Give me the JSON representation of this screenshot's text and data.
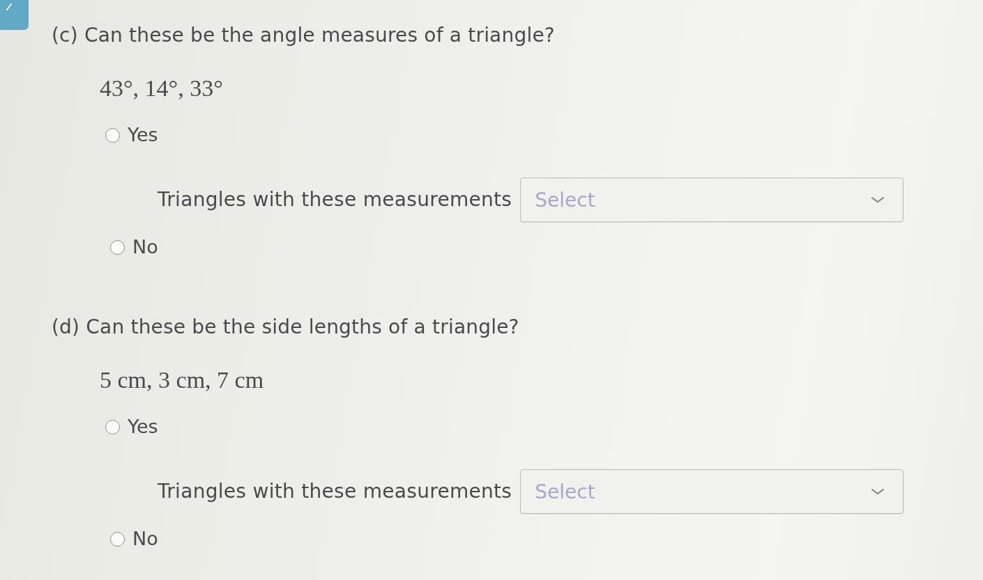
{
  "questions": [
    {
      "heading": "(c) Can these be the angle measures of a triangle?",
      "values": "43°, 14°, 33°",
      "options": [
        {
          "label": "Yes",
          "selected": false,
          "followup": {
            "label": "Triangles with these measurements",
            "placeholder": "Select"
          }
        },
        {
          "label": "No",
          "selected": false
        }
      ]
    },
    {
      "heading": "(d) Can these be the side lengths of a triangle?",
      "values": "5 cm, 3 cm, 7 cm",
      "options": [
        {
          "label": "Yes",
          "selected": false,
          "followup": {
            "label": "Triangles with these measurements",
            "placeholder": "Select"
          }
        },
        {
          "label": "No",
          "selected": false
        }
      ]
    }
  ]
}
